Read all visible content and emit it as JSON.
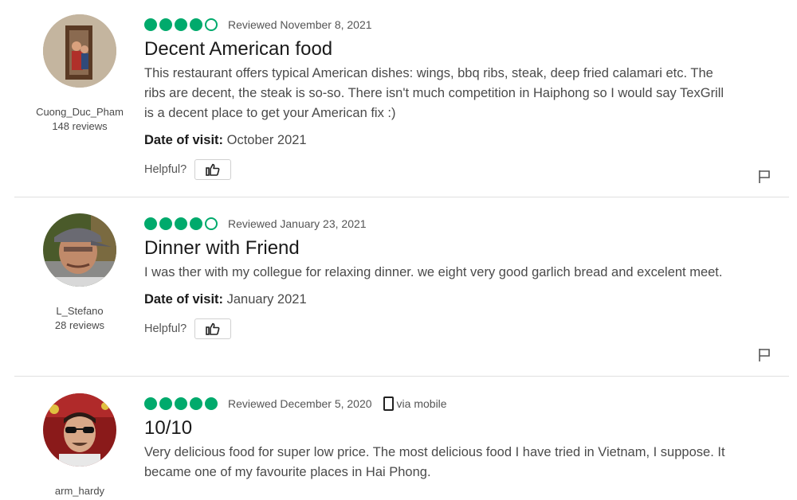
{
  "reviews": [
    {
      "username": "Cuong_Duc_Pham",
      "review_count": "148 reviews",
      "rating": 4,
      "reviewed_date": "Reviewed November 8, 2021",
      "title": "Decent American food",
      "body": "This restaurant offers typical American dishes: wings, bbq ribs, steak, deep fried calamari etc. The ribs are decent, the steak is so-so. There isn't much competition in Haiphong so I would say TexGrill is a decent place to get your American fix :)",
      "visit_label": "Date of visit:",
      "visit_value": "October 2021",
      "helpful_label": "Helpful?"
    },
    {
      "username": "L_Stefano",
      "review_count": "28 reviews",
      "rating": 4,
      "reviewed_date": "Reviewed January 23, 2021",
      "title": "Dinner with Friend",
      "body": "I was ther with my collegue for relaxing dinner. we eight very good garlich bread and excelent meet.",
      "visit_label": "Date of visit:",
      "visit_value": "January 2021",
      "helpful_label": "Helpful?"
    },
    {
      "username": "arm_hardy",
      "rating": 5,
      "reviewed_date": "Reviewed December 5, 2020",
      "via": "via mobile",
      "title": "10/10",
      "body": "Very delicious food for super low price. The most delicious food I have tried in Vietnam, I suppose. It became one of my favourite places in Hai Phong."
    }
  ],
  "colors": {
    "bubble_green": "#00aa6c",
    "divider": "#e0e0e0"
  },
  "icons": {
    "thumbs_up": "thumbs-up-icon",
    "flag": "flag-icon",
    "mobile": "mobile-phone-icon"
  }
}
